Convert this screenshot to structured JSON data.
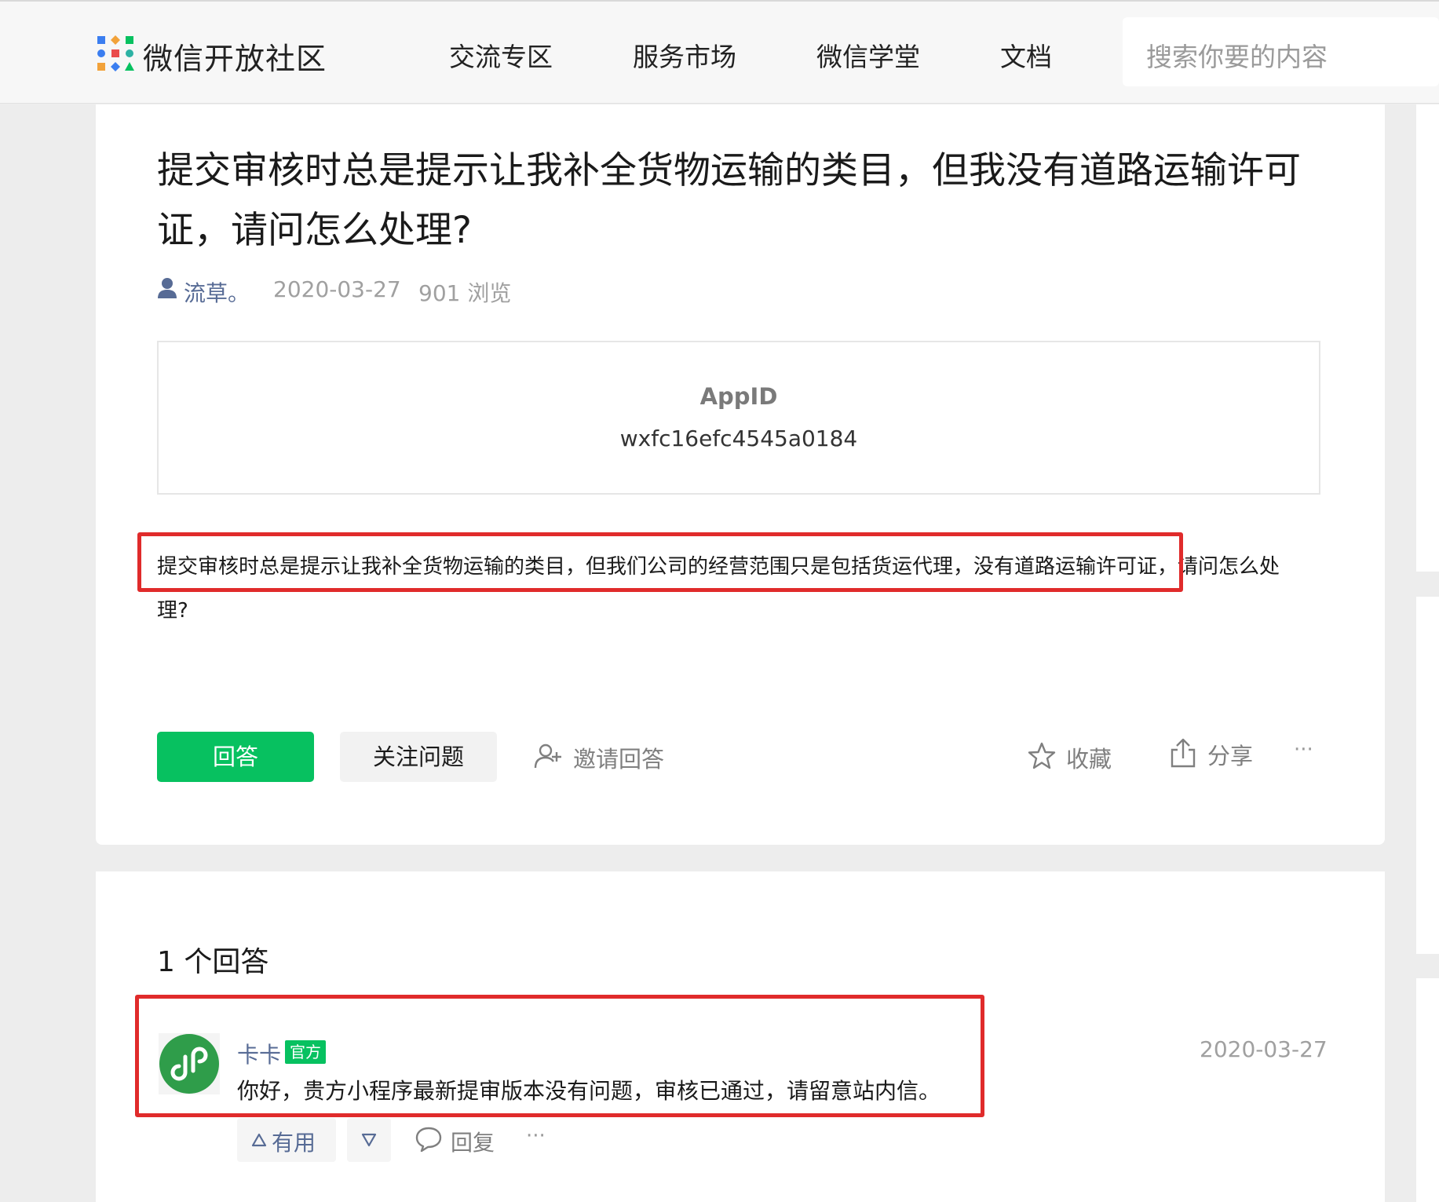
{
  "header": {
    "brand": "微信开放社区",
    "nav": [
      "交流专区",
      "服务市场",
      "微信学堂",
      "文档"
    ],
    "search_placeholder": "搜索你要的内容"
  },
  "question": {
    "title": "提交审核时总是提示让我补全货物运输的类目，但我没有道路运输许可证，请问怎么处理?",
    "author": "流草。",
    "date": "2020-03-27",
    "views": "901 浏览",
    "appid_label": "AppID",
    "appid_value": "wxfc16efc4545a0184",
    "body": "提交审核时总是提示让我补全货物运输的类目，但我们公司的经营范围只是包括货运代理，没有道路运输许可证，请问怎么处理?"
  },
  "actions": {
    "answer": "回答",
    "follow": "关注问题",
    "invite": "邀请回答",
    "favorite": "收藏",
    "share": "分享",
    "more": "···"
  },
  "answers": {
    "count_label": "1 个回答",
    "items": [
      {
        "name": "卡卡",
        "badge": "官方",
        "date": "2020-03-27",
        "text": "你好，贵方小程序最新提审版本没有问题，审核已通过，请留意站内信。",
        "useful": "有用",
        "reply": "回复",
        "more": "···"
      }
    ]
  },
  "colors": {
    "accent_green": "#07c160",
    "link_blue": "#576b95",
    "annotation_red": "#e02b2b"
  }
}
